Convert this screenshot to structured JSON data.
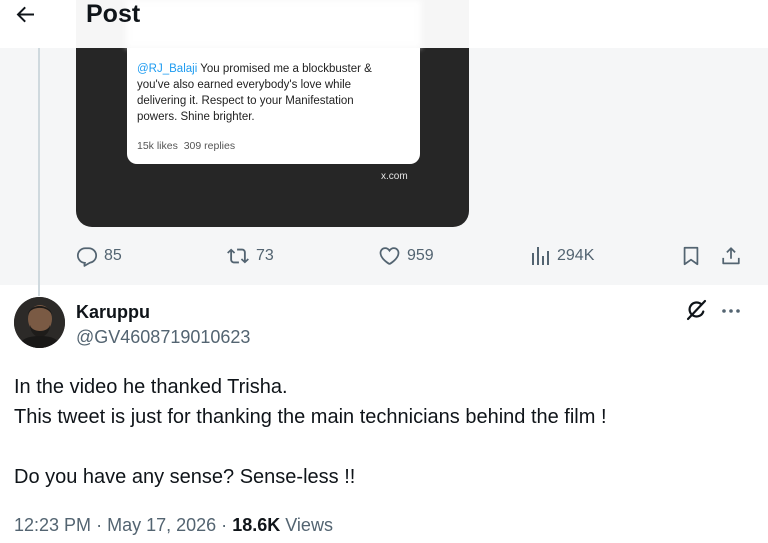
{
  "header": {
    "title": "Post",
    "back_icon": "arrow-left-icon"
  },
  "embedded_card": {
    "mention": "@RJ_Balaji",
    "text": " You promised me a blockbuster & you've also earned everybody's love while delivering it. Respect to your Manifestation powers. Shine brighter.",
    "likes": "15k likes",
    "replies": "309 replies",
    "source": "x.com"
  },
  "actions": {
    "replies": "85",
    "reposts": "73",
    "likes": "959",
    "views": "294K"
  },
  "reply": {
    "display_name": "Karuppu",
    "handle": "@GV4608719010623",
    "lines": [
      "In the video he thanked Trisha.",
      "This tweet is just for thanking the main technicians behind the film !",
      "",
      "Do you have any sense? Sense-less !!"
    ],
    "time": "12:23 PM",
    "separator": "·",
    "date": "May 17, 2026",
    "views_count": "18.6K",
    "views_label": "Views"
  },
  "colors": {
    "accent": "#1d9bf0",
    "secondary_text": "#536471",
    "primary_text": "#0f1419",
    "media_bg": "#262626",
    "upper_bg": "#f5f6f7"
  }
}
